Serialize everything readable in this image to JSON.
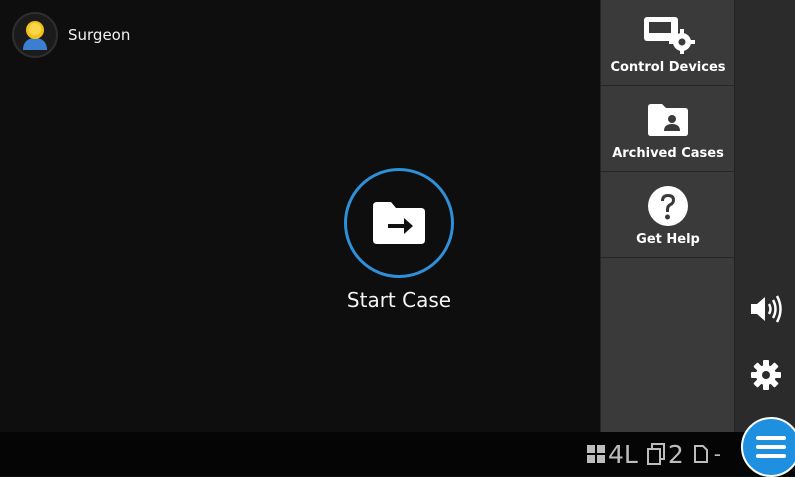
{
  "user": {
    "name": "Surgeon",
    "icon": "user-avatar-icon"
  },
  "main": {
    "start_case_label": "Start Case",
    "start_case_icon": "folder-arrow-icon"
  },
  "panel": {
    "items": [
      {
        "label": "Control Devices",
        "icon": "devices-gear-icon"
      },
      {
        "label": "Archived Cases",
        "icon": "folder-user-icon"
      },
      {
        "label": "Get Help",
        "icon": "question-icon"
      }
    ]
  },
  "rail": {
    "volume_icon": "volume-icon",
    "settings_icon": "gear-icon"
  },
  "status": {
    "layout_value": "4L",
    "copies_value": "2",
    "document_value": "-"
  },
  "menu": {
    "icon": "hamburger-menu-icon"
  },
  "colors": {
    "accent": "#2f8fd8",
    "panel_bg": "#3a3a3a",
    "menu_bg": "#1f8fe0"
  }
}
